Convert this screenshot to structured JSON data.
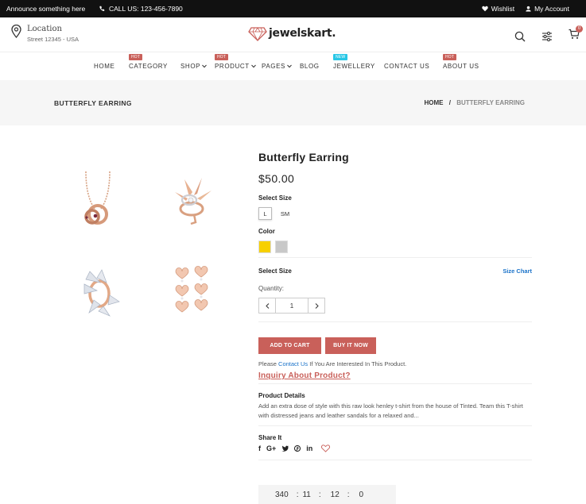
{
  "topbar": {
    "announce": "Announce something here",
    "call": "CALL US: 123-456-7890",
    "wishlist": "Wishlist",
    "account": "My Account"
  },
  "header": {
    "location_title": "Location",
    "location_address": "Street 12345 - USA",
    "logo_text": "jewelskart.",
    "cart_count": "0"
  },
  "nav": {
    "items": [
      {
        "label": "HOME",
        "badge": ""
      },
      {
        "label": "CATEGORY",
        "badge": "HOT"
      },
      {
        "label": "SHOP",
        "badge": ""
      },
      {
        "label": "PRODUCT",
        "badge": "HOT"
      },
      {
        "label": "PAGES",
        "badge": ""
      },
      {
        "label": "BLOG",
        "badge": ""
      },
      {
        "label": "JEWELLERY",
        "badge": "NEW"
      },
      {
        "label": "CONTACT US",
        "badge": ""
      },
      {
        "label": "ABOUT US",
        "badge": "HOT"
      }
    ]
  },
  "banner": {
    "title": "BUTTERFLY EARRING",
    "crumb_home": "HOME",
    "crumb_sep": "/",
    "crumb_current": "BUTTERFLY EARRING"
  },
  "product": {
    "name": "Butterfly Earring",
    "price": "$50.00",
    "select_size_label": "Select Size",
    "sizes": [
      "L",
      "SM"
    ],
    "color_label": "Color",
    "colors": [
      "#f7d000",
      "#c8c8c8"
    ],
    "select_size_label_2": "Select Size",
    "size_chart": "Size Chart",
    "quantity_label": "Quantity:",
    "quantity_value": "1",
    "add_to_cart": "ADD TO CART",
    "buy_now": "BUY IT NOW",
    "contact_pre": "Please",
    "contact_link": "Contact Us",
    "contact_post": "If You Are Interested In This Product.",
    "inquiry": "Inquiry About Product?",
    "details_label": "Product Details",
    "details_text": "Add an extra dose of style with this raw look henley t-shirt from the house of Tinted. Team this T-shirt with distressed jeans and leather sandals for a relaxed and...",
    "share_label": "Share It",
    "share_icons": [
      "f",
      "G+",
      "twitter",
      "pinterest",
      "in"
    ]
  },
  "countdown": {
    "days": "340",
    "hours": "11",
    "minutes": "12",
    "seconds": "0",
    "sep": ":"
  },
  "colors": {
    "accent": "#c9605a",
    "link": "#1b73c9",
    "topbar": "#111111",
    "hot_badge": "#c9605a",
    "new_badge": "#28c7e6"
  }
}
